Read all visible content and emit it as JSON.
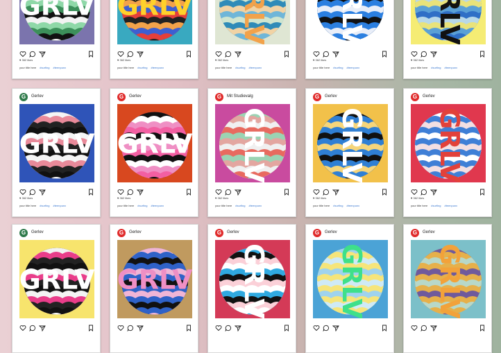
{
  "colors": {
    "brand_red": "#e02b2b",
    "brand_green": "#2f7a4a",
    "hashtag_blue": "#3a78d0"
  },
  "icons": [
    "heart-icon",
    "comment-icon",
    "share-icon",
    "bookmark-icon"
  ],
  "posts": [
    {
      "username": "",
      "avatar": "",
      "avatar_color": "#e02b2b",
      "likes": "362 likes",
      "caption": "your title here",
      "tags": [
        "#surfing",
        "#teenpunx"
      ],
      "bg": "#7b74ad",
      "stripes": [
        "#111111",
        "#f3f3f3",
        "#8fd8a8",
        "#3c8f5a"
      ],
      "art": "GRLV",
      "letter": "#ffffff",
      "rotation": 0
    },
    {
      "username": "",
      "avatar": "",
      "avatar_color": "#e02b2b",
      "likes": "362 likes",
      "caption": "your title here",
      "tags": [
        "#surfing",
        "#teenpunx"
      ],
      "bg": "#39a9c0",
      "stripes": [
        "#e53f3a",
        "#222222",
        "#f2a24a",
        "#3d5fd1"
      ],
      "art": "GRLV",
      "letter": "#ffd12b",
      "rotation": 0
    },
    {
      "username": "",
      "avatar": "",
      "avatar_color": "#e02b2b",
      "likes": "362 likes",
      "caption": "your title here",
      "tags": [
        "#surfing",
        "#teenpunx"
      ],
      "bg": "#dfe6d3",
      "stripes": [
        "#6fb6d8",
        "#cfe5cf",
        "#2f8bb8",
        "#f1d3a5"
      ],
      "art": "GRLV",
      "letter": "#f2a24a",
      "rotation": 90
    },
    {
      "username": "",
      "avatar": "",
      "avatar_color": "#e02b2b",
      "likes": "362 likes",
      "caption": "your title here",
      "tags": [
        "#surfing",
        "#teenpunx"
      ],
      "bg": "#ffffff",
      "stripes": [
        "#2b7fe0",
        "#111111",
        "#2b7fe0",
        "#e9eef8"
      ],
      "art": "GRLV",
      "letter": "#ffffff",
      "rotation": 90
    },
    {
      "username": "",
      "avatar": "",
      "avatar_color": "#e02b2b",
      "likes": "362 likes",
      "caption": "your title here",
      "tags": [
        "#surfing",
        "#teenpunx"
      ],
      "bg": "#f5ec74",
      "stripes": [
        "#2f6fc6",
        "#b8d8e8",
        "#e9e37a",
        "#5aa0d6"
      ],
      "art": "GRLV",
      "letter": "#111111",
      "rotation": 90
    },
    {
      "username": "Gerlev",
      "avatar": "G",
      "avatar_color": "#2f7a4a",
      "likes": "362 likes",
      "caption": "your title here",
      "tags": [
        "#surfing",
        "#teenpunx"
      ],
      "bg": "#2f54b8",
      "stripes": [
        "#111111",
        "#f5f5f5",
        "#e98a9a",
        "#222222"
      ],
      "art": "GRLV",
      "letter": "#ffffff",
      "rotation": 0
    },
    {
      "username": "Gerlev",
      "avatar": "G",
      "avatar_color": "#e02b2b",
      "likes": "362 likes",
      "caption": "your title here",
      "tags": [
        "#surfing",
        "#teenpunx"
      ],
      "bg": "#d8481f",
      "stripes": [
        "#f25fa2",
        "#111111",
        "#ffffff",
        "#ef8fc4"
      ],
      "art": "GRLV",
      "letter": "#ffffff",
      "rotation": 0
    },
    {
      "username": "Mit Studievalg",
      "avatar": "G",
      "avatar_color": "#e02b2b",
      "likes": "362 likes",
      "caption": "your title here",
      "tags": [
        "#surfing",
        "#teenpunx"
      ],
      "bg": "#c94b9f",
      "stripes": [
        "#e86a5f",
        "#9bd3b3",
        "#e3a6a0",
        "#f0f0f0"
      ],
      "art": "GRLV",
      "letter": "#ffffff",
      "rotation": 90
    },
    {
      "username": "Gerlev",
      "avatar": "G",
      "avatar_color": "#e02b2b",
      "likes": "362 likes",
      "caption": "your title here",
      "tags": [
        "#surfing",
        "#teenpunx"
      ],
      "bg": "#f2c14a",
      "stripes": [
        "#2f7fd4",
        "#111111",
        "#2f7fd4",
        "#f6d57a"
      ],
      "art": "GRLV",
      "letter": "#ffffff",
      "rotation": 90
    },
    {
      "username": "Gerlev",
      "avatar": "G",
      "avatar_color": "#e02b2b",
      "likes": "362 likes",
      "caption": "your title here",
      "tags": [
        "#surfing",
        "#teenpunx"
      ],
      "bg": "#e0384e",
      "stripes": [
        "#3f7fd6",
        "#ffffff",
        "#3f7fd6",
        "#f3dfe2"
      ],
      "art": "GRLV",
      "letter": "#e2413a",
      "rotation": 90
    },
    {
      "username": "Gerlev",
      "avatar": "G",
      "avatar_color": "#2f7a4a",
      "likes": "",
      "caption": "",
      "tags": [],
      "bg": "#f7e46d",
      "stripes": [
        "#111111",
        "#f3f3f3",
        "#e93d8a",
        "#222222"
      ],
      "art": "GRLV",
      "letter": "#ffffff",
      "rotation": 0
    },
    {
      "username": "Gerlev",
      "avatar": "G",
      "avatar_color": "#e02b2b",
      "likes": "",
      "caption": "",
      "tags": [],
      "bg": "#c09a5f",
      "stripes": [
        "#2f62c8",
        "#f0b5d6",
        "#2f62c8",
        "#111111"
      ],
      "art": "GRLV",
      "letter": "#ef8fc4",
      "rotation": 0
    },
    {
      "username": "Gerlev",
      "avatar": "G",
      "avatar_color": "#e02b2b",
      "likes": "",
      "caption": "",
      "tags": [],
      "bg": "#d43a57",
      "stripes": [
        "#ffffff",
        "#2fa9e0",
        "#111111",
        "#fbd0d8"
      ],
      "art": "GRLV",
      "letter": "#ffffff",
      "rotation": 90
    },
    {
      "username": "Gerlev",
      "avatar": "G",
      "avatar_color": "#e02b2b",
      "likes": "",
      "caption": "",
      "tags": [],
      "bg": "#4ba3d6",
      "stripes": [
        "#f6e57a",
        "#9fd3ee",
        "#f6e57a",
        "#cfeaf6"
      ],
      "art": "GRLV",
      "letter": "#3ee08a",
      "rotation": 90
    },
    {
      "username": "Gerlev",
      "avatar": "G",
      "avatar_color": "#e02b2b",
      "likes": "",
      "caption": "",
      "tags": [],
      "bg": "#7cc0c9",
      "stripes": [
        "#e6b04a",
        "#6f5a9c",
        "#e6b04a",
        "#b7d8c9"
      ],
      "art": "GRLV",
      "letter": "#f2a23a",
      "rotation": 90
    }
  ]
}
